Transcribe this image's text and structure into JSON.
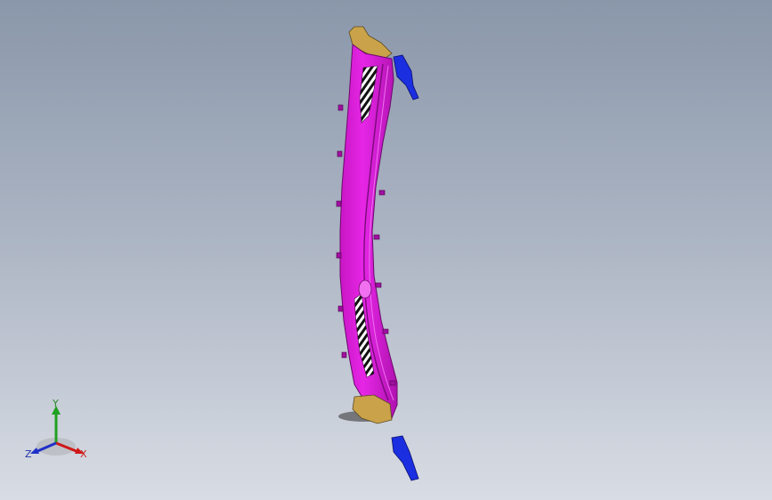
{
  "viewport": {
    "background_top": "#8a97aa",
    "background_bottom": "#d8dce4"
  },
  "model": {
    "body_color": "#e21ee0",
    "bracket_color": "#1b2ee0",
    "end_cap_color": "#c9a24a",
    "vent_colors": [
      "#111111",
      "#ffffff"
    ]
  },
  "triad": {
    "x_label": "X",
    "y_label": "Y",
    "z_label": "Z",
    "x_color": "#d01818",
    "y_color": "#20a020",
    "z_color": "#2030c8"
  }
}
